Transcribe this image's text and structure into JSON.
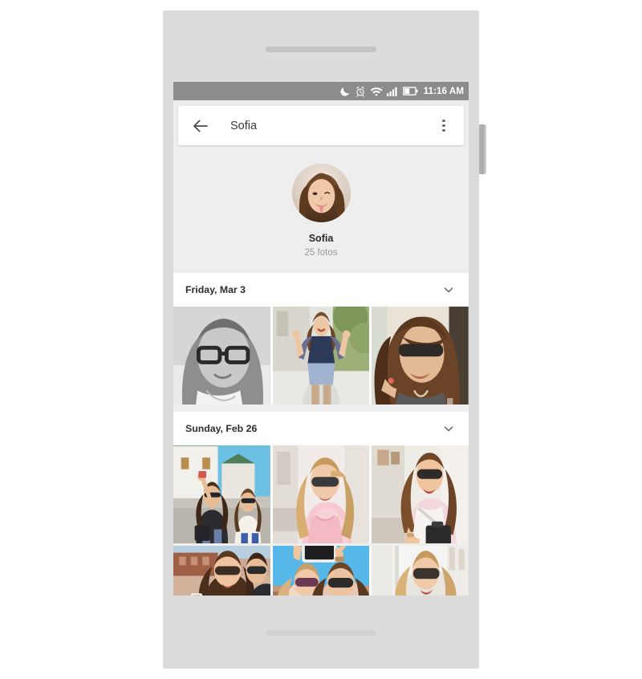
{
  "status_bar": {
    "time": "11:16 AM",
    "icons": [
      "moon-icon",
      "alarm-icon",
      "wifi-icon",
      "signal-icon",
      "battery-icon"
    ],
    "background_color": "#8c8c8c"
  },
  "app_bar": {
    "back_label": "back-arrow-icon",
    "title": "Sofia",
    "overflow_label": "overflow-menu-icon"
  },
  "profile": {
    "name": "Sofia",
    "photo_count": "25 fotos",
    "avatar_alt": "Sofia avatar"
  },
  "sections": [
    {
      "title": "Friday, Mar 3",
      "collapse_icon": "chevron-down-icon",
      "rows": [
        {
          "photos": [
            {
              "alt": "Black and white portrait of woman with glasses",
              "palette": [
                "#cfcfcf",
                "#9a9a9a",
                "#5c5c5c"
              ]
            },
            {
              "alt": "Woman in navy top on street making peace sign",
              "palette": [
                "#dfe3dc",
                "#2e3b55",
                "#8fa06e"
              ]
            },
            {
              "alt": "Woman with sunglasses and wind-blown hair",
              "palette": [
                "#e6e2d8",
                "#5a3f33",
                "#3a3a3a"
              ]
            }
          ]
        }
      ]
    },
    {
      "title": "Sunday, Feb 26",
      "collapse_icon": "chevron-down-icon",
      "rows": [
        {
          "photos": [
            {
              "alt": "Two women walking by white buildings, one waving",
              "palette": [
                "#6cc0e4",
                "#e8eee8",
                "#2f2f33"
              ]
            },
            {
              "alt": "Blonde woman in pink top with sunglasses",
              "palette": [
                "#f0e7e4",
                "#f3c6cb",
                "#c9a477"
              ]
            },
            {
              "alt": "Woman smiling with black handbag",
              "palette": [
                "#efece6",
                "#d8bfa0",
                "#333333"
              ]
            }
          ]
        },
        {
          "photos": [
            {
              "alt": "Two friends with phone outdoors",
              "palette": [
                "#b8cfe0",
                "#6a4a38",
                "#2c2c2c"
              ]
            },
            {
              "alt": "Two friends taking a selfie with a phone",
              "palette": [
                "#55b8e8",
                "#f0dcd0",
                "#2b2b2b"
              ]
            },
            {
              "alt": "Blonde woman with sunglasses near white wall",
              "palette": [
                "#f4f4f2",
                "#d9b277",
                "#3c3c3c"
              ]
            }
          ]
        }
      ]
    }
  ],
  "device": {
    "frame_color": "#dcdcdc",
    "screen_background": "#eeeeee"
  }
}
